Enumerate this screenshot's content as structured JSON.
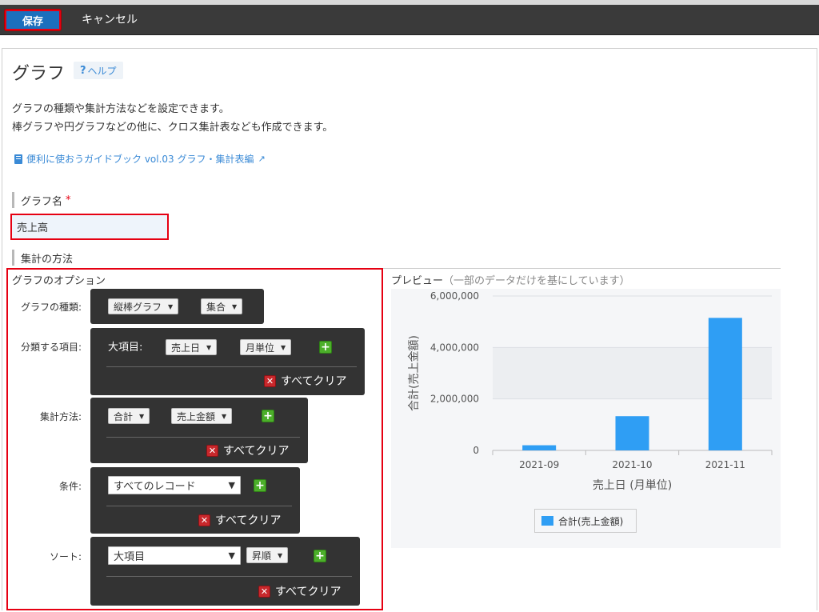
{
  "toolbar": {
    "save_label": "保存",
    "cancel_label": "キャンセル"
  },
  "page": {
    "title": "グラフ",
    "help_label": "ヘルプ",
    "help_icon_char": "?",
    "description_1": "グラフの種類や集計方法などを設定できます。",
    "description_2": "棒グラフや円グラフなどの他に、クロス集計表なども作成できます。",
    "guide_link": "便利に使おうガイドブック vol.03 グラフ・集計表編"
  },
  "graph_name": {
    "label": "グラフ名",
    "required_mark": "*",
    "value": "売上高"
  },
  "aggregation_section": {
    "label": "集計の方法"
  },
  "options": {
    "title": "グラフのオプション",
    "clear_all_label": "すべてクリア",
    "chart_type": {
      "label": "グラフの種類:",
      "type_value": "縦棒グラフ",
      "mode_value": "集合"
    },
    "grouping": {
      "label": "分類する項目:",
      "major_label": "大項目:",
      "field_value": "売上日",
      "unit_value": "月単位"
    },
    "aggregation": {
      "label": "集計方法:",
      "func_value": "合計",
      "field_value": "売上金額"
    },
    "condition": {
      "label": "条件:",
      "value": "すべてのレコード"
    },
    "sort": {
      "label": "ソート:",
      "field_value": "大項目",
      "order_value": "昇順"
    }
  },
  "preview": {
    "title": "プレビュー",
    "subtitle": "（一部のデータだけを基にしています）"
  },
  "chart_data": {
    "type": "bar",
    "categories": [
      "2021-09",
      "2021-10",
      "2021-11"
    ],
    "series": [
      {
        "name": "合計(売上金額)",
        "values": [
          200000,
          1330000,
          5150000
        ]
      }
    ],
    "xlabel": "売上日 (月単位)",
    "ylabel": "合計(売上金額)",
    "ylim": [
      0,
      6000000
    ],
    "yticks": [
      0,
      2000000,
      4000000,
      6000000
    ],
    "ytick_labels": [
      "0",
      "2,000,000",
      "4,000,000",
      "6,000,000"
    ],
    "grid": true,
    "legend_position": "bottom",
    "bar_color": "#2f9ef4"
  }
}
